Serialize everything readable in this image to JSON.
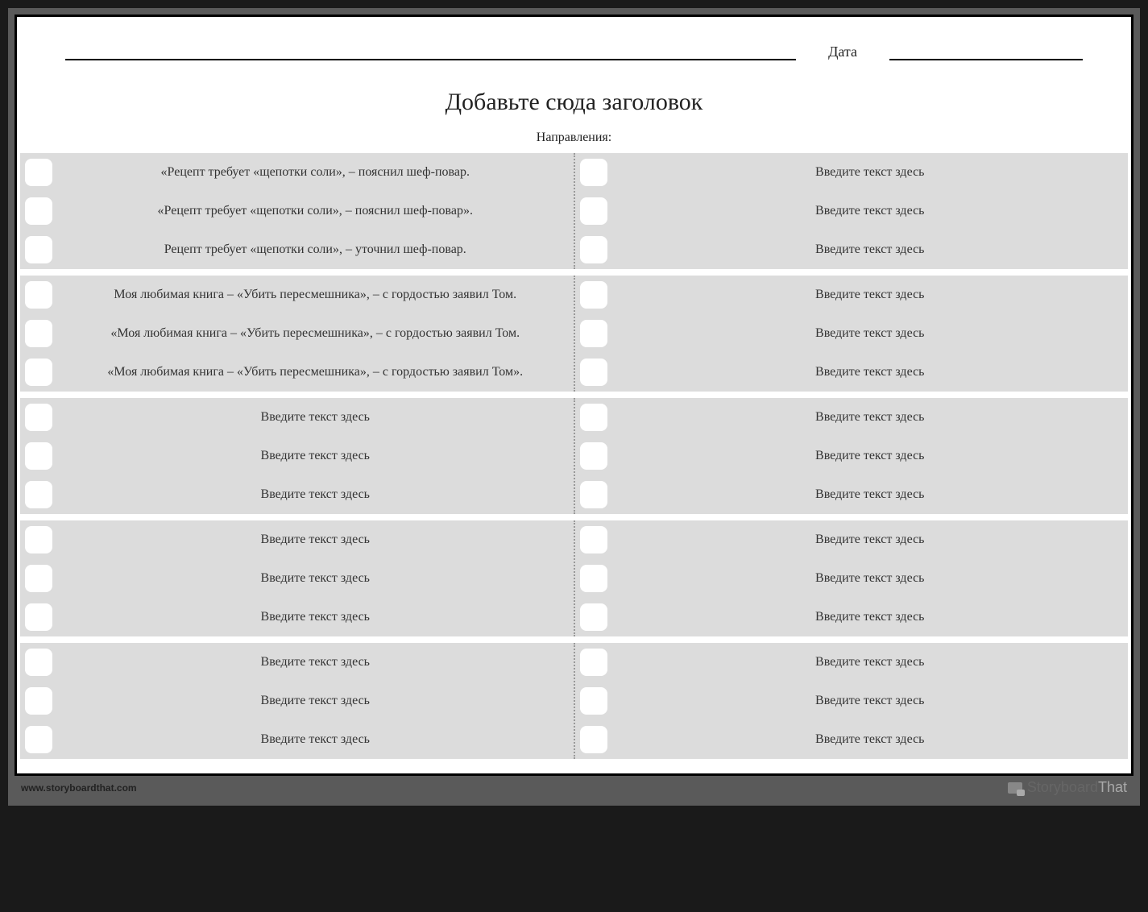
{
  "header": {
    "date_label": "Дата"
  },
  "title": "Добавьте сюда заголовок",
  "directions_label": "Направления:",
  "placeholder": "Введите текст здесь",
  "blocks": [
    {
      "left": [
        "«Рецепт требует «щепотки соли», – пояснил шеф-повар.",
        "«Рецепт требует «щепотки соли», – пояснил шеф-повар».",
        "Рецепт требует «щепотки соли», – уточнил шеф-повар."
      ],
      "right": [
        "Введите текст здесь",
        "Введите текст здесь",
        "Введите текст здесь"
      ]
    },
    {
      "left": [
        "Моя любимая книга – «Убить пересмешника», – с гордостью заявил Том.",
        "«Моя любимая книга – «Убить пересмешника», – с гордостью заявил Том.",
        "«Моя любимая книга – «Убить пересмешника», – с гордостью заявил Том»."
      ],
      "right": [
        "Введите текст здесь",
        "Введите текст здесь",
        "Введите текст здесь"
      ]
    },
    {
      "left": [
        "Введите текст здесь",
        "Введите текст здесь",
        "Введите текст здесь"
      ],
      "right": [
        "Введите текст здесь",
        "Введите текст здесь",
        "Введите текст здесь"
      ]
    },
    {
      "left": [
        "Введите текст здесь",
        "Введите текст здесь",
        "Введите текст здесь"
      ],
      "right": [
        "Введите текст здесь",
        "Введите текст здесь",
        "Введите текст здесь"
      ]
    },
    {
      "left": [
        "Введите текст здесь",
        "Введите текст здесь",
        "Введите текст здесь"
      ],
      "right": [
        "Введите текст здесь",
        "Введите текст здесь",
        "Введите текст здесь"
      ]
    }
  ],
  "footer": {
    "url": "www.storyboardthat.com",
    "brand_strong": "Storyboard",
    "brand_light": "That"
  }
}
